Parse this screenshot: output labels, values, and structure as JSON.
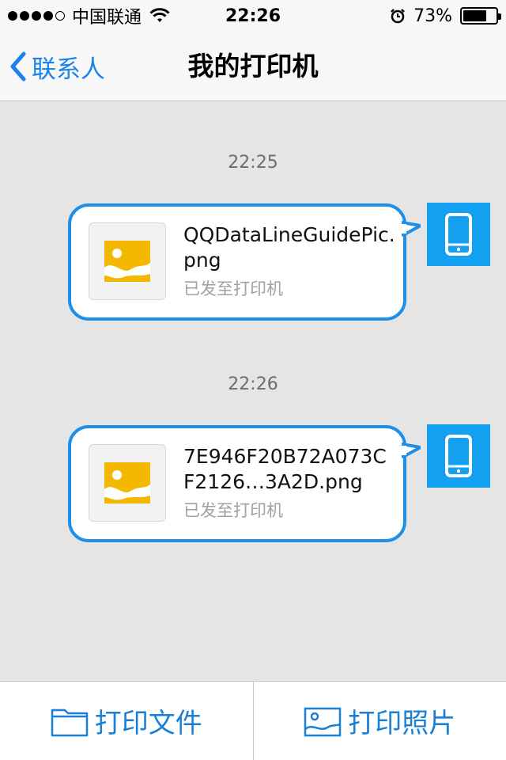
{
  "status_bar": {
    "carrier": "中国联通",
    "time": "22:26",
    "battery": "73%",
    "battery_level": 0.73
  },
  "nav": {
    "back_label": "联系人",
    "title": "我的打印机"
  },
  "messages": [
    {
      "timestamp": "22:25",
      "file_name": "QQDataLineGuidePic.png",
      "status": "已发至打印机"
    },
    {
      "timestamp": "22:26",
      "file_name": "7E946F20B72A073CF2126…3A2D.png",
      "status": "已发至打印机"
    }
  ],
  "toolbar": {
    "print_file_label": "打印文件",
    "print_photo_label": "打印照片"
  },
  "icons": {
    "back": "chevron-left-icon",
    "file_thumb": "image-file-icon",
    "avatar": "phone-icon",
    "print_file": "folder-icon",
    "print_photo": "photo-icon"
  },
  "colors": {
    "accent": "#1a82e8",
    "bubble_border": "#1e8fe8",
    "avatar_bg": "#14a0f0",
    "image_icon": "#f5b800"
  }
}
